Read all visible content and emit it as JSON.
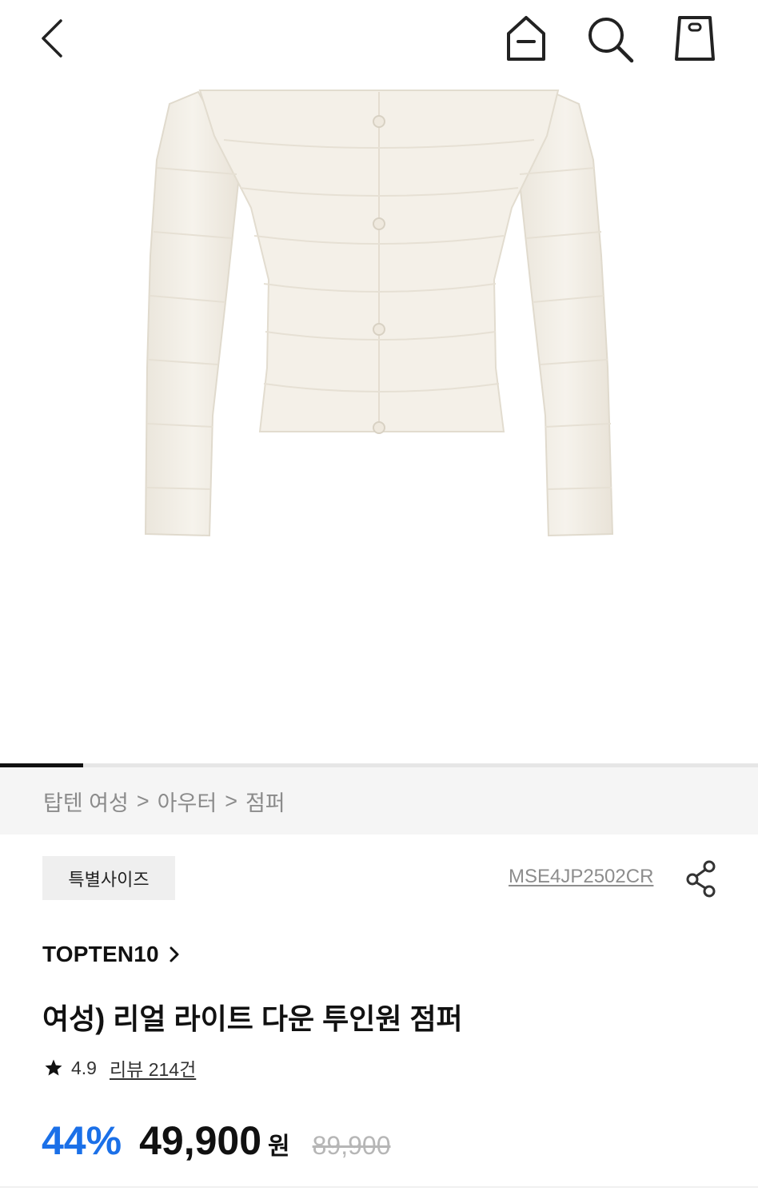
{
  "header": {
    "back_icon": "chevron-left-icon",
    "home_icon": "home-icon",
    "search_icon": "search-icon",
    "bag_icon": "shopping-bag-icon"
  },
  "gallery": {
    "image_subject": "white padded down jacket",
    "progress_fraction": 0.11
  },
  "breadcrumb": {
    "items": [
      "탑텐 여성",
      "아우터",
      "점퍼"
    ],
    "separator": ">"
  },
  "product": {
    "badge": "특별사이즈",
    "code": "MSE4JP2502CR",
    "brand": "TOPTEN10",
    "title": "여성) 리얼 라이트 다운 투인원 점퍼",
    "rating": "4.9",
    "review_label": "리뷰 214건"
  },
  "price": {
    "discount": "44%",
    "sale": "49,900",
    "currency": "원",
    "original": "89,900"
  },
  "colors": {
    "accent": "#1b70e8",
    "breadcrumb_bg": "#f5f5f5",
    "badge_bg": "#efefef",
    "muted_text": "#8b8b8b"
  }
}
